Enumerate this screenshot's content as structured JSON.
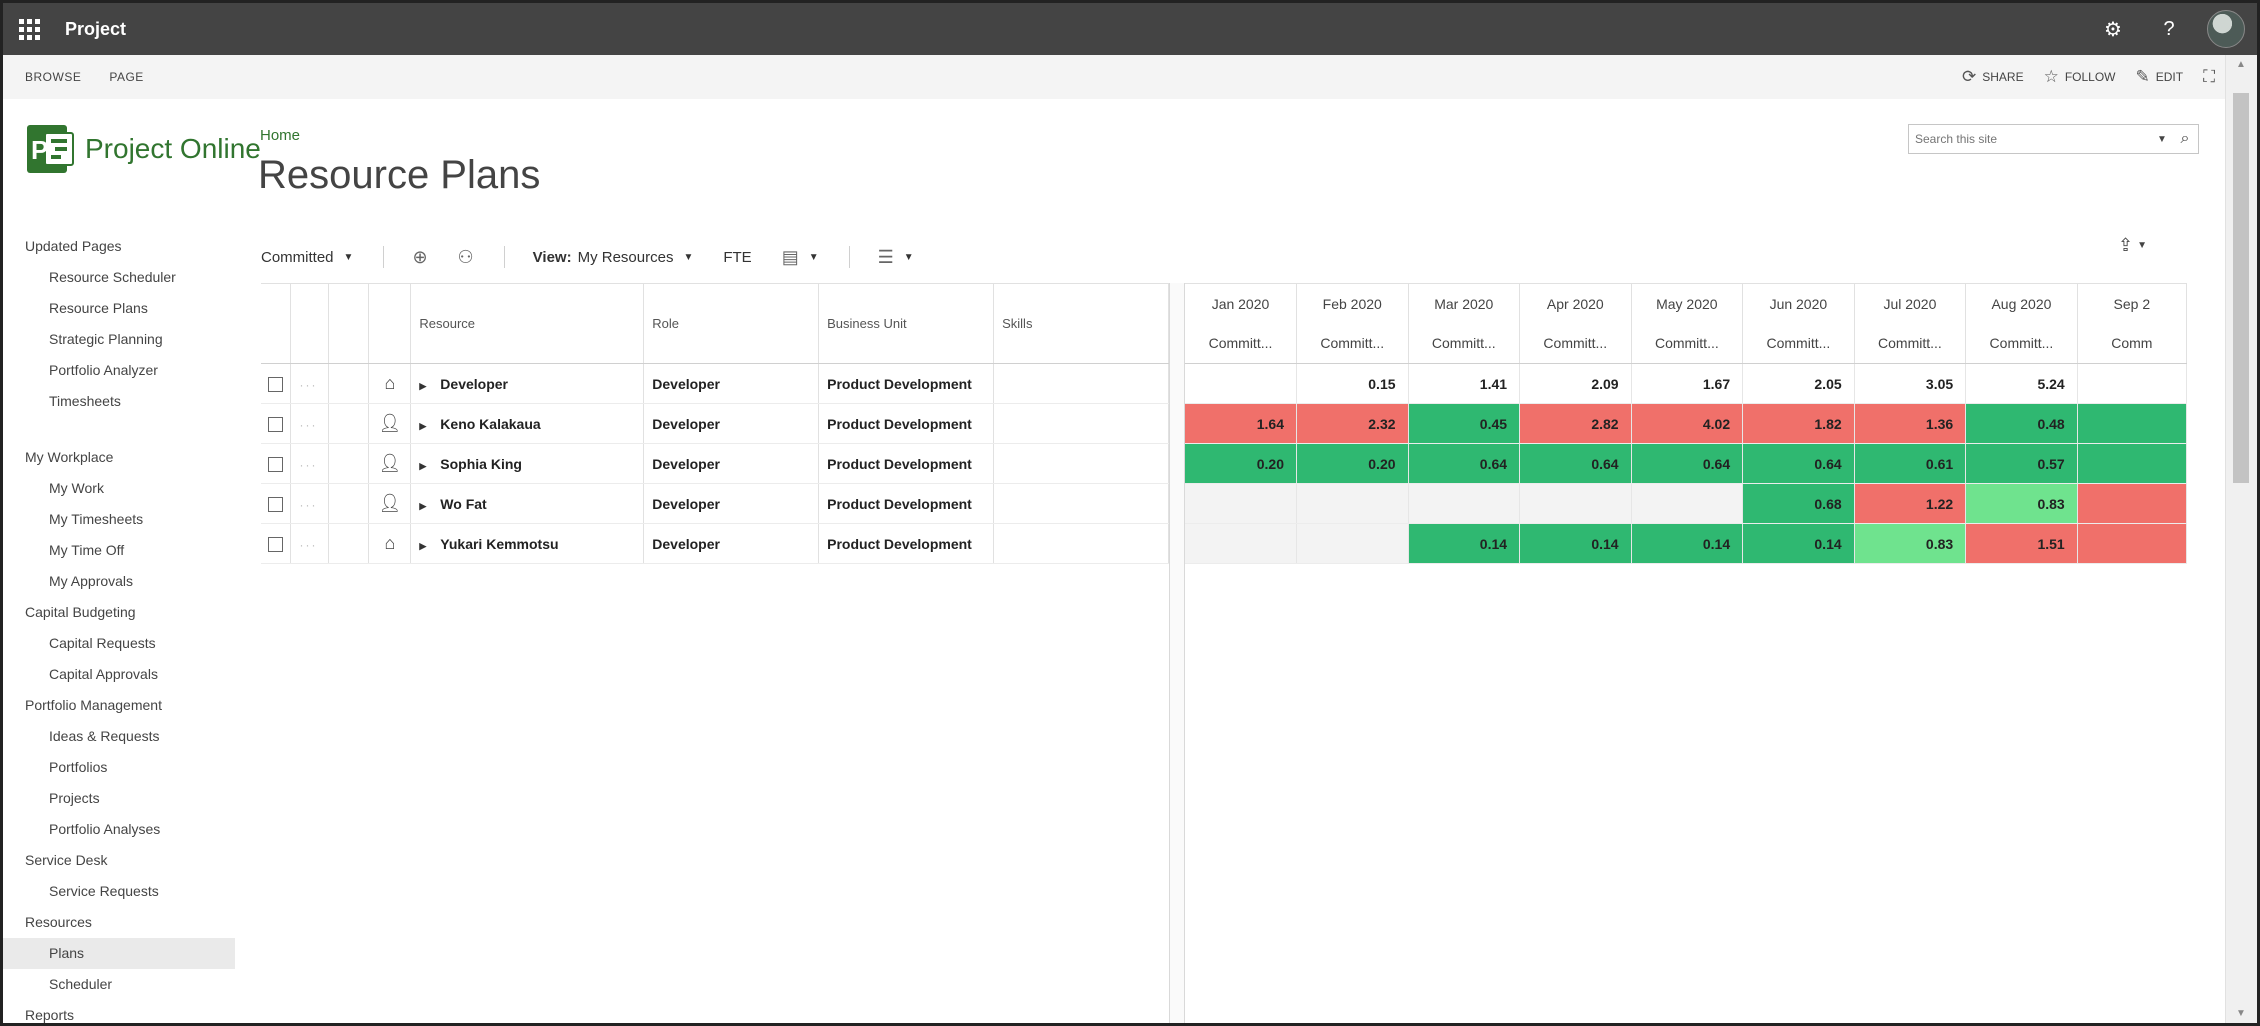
{
  "suite": {
    "title": "Project"
  },
  "ribbon": {
    "tabs": [
      "BROWSE",
      "PAGE"
    ],
    "actions": [
      "SHARE",
      "FOLLOW",
      "EDIT"
    ]
  },
  "logo": {
    "text": "Project Online",
    "brand_color": "#31752f"
  },
  "breadcrumb": "Home",
  "page_title": "Resource Plans",
  "search": {
    "placeholder": "Search this site"
  },
  "nav": [
    {
      "label": "Updated Pages",
      "level": 0
    },
    {
      "label": "Resource Scheduler",
      "level": 1
    },
    {
      "label": "Resource Plans",
      "level": 1
    },
    {
      "label": "Strategic Planning",
      "level": 1
    },
    {
      "label": "Portfolio Analyzer",
      "level": 1
    },
    {
      "label": "Timesheets",
      "level": 1
    },
    {
      "label": "",
      "level": -1
    },
    {
      "label": "My Workplace",
      "level": 0
    },
    {
      "label": "My Work",
      "level": 1
    },
    {
      "label": "My Timesheets",
      "level": 1
    },
    {
      "label": "My Time Off",
      "level": 1
    },
    {
      "label": "My Approvals",
      "level": 1
    },
    {
      "label": "Capital Budgeting",
      "level": 0
    },
    {
      "label": "Capital Requests",
      "level": 1
    },
    {
      "label": "Capital Approvals",
      "level": 1
    },
    {
      "label": "Portfolio Management",
      "level": 0
    },
    {
      "label": "Ideas & Requests",
      "level": 1
    },
    {
      "label": "Portfolios",
      "level": 1
    },
    {
      "label": "Projects",
      "level": 1
    },
    {
      "label": "Portfolio Analyses",
      "level": 1
    },
    {
      "label": "Service Desk",
      "level": 0
    },
    {
      "label": "Service Requests",
      "level": 1
    },
    {
      "label": "Resources",
      "level": 0
    },
    {
      "label": "Plans",
      "level": 1,
      "selected": true
    },
    {
      "label": "Scheduler",
      "level": 1
    },
    {
      "label": "Reports",
      "level": 0
    }
  ],
  "toolbar": {
    "committed": "Committed",
    "view_label": "View:",
    "view_value": "My Resources",
    "fte": "FTE"
  },
  "grid": {
    "columns": {
      "resource": "Resource",
      "role": "Role",
      "business_unit": "Business Unit",
      "skills": "Skills"
    },
    "months": [
      "Jan 2020",
      "Feb 2020",
      "Mar 2020",
      "Apr 2020",
      "May 2020",
      "Jun 2020",
      "Jul 2020",
      "Aug 2020",
      "Sep 2"
    ],
    "sub_header": [
      "Committ...",
      "Committ...",
      "Committ...",
      "Committ...",
      "Committ...",
      "Committ...",
      "Committ...",
      "Committ...",
      "Comm"
    ],
    "rows": [
      {
        "icon": "generic-resource-icon",
        "resource": "Developer",
        "role": "Developer",
        "business_unit": "Product Development",
        "skills": "",
        "values": [
          "",
          "0.15",
          "1.41",
          "2.09",
          "1.67",
          "2.05",
          "3.05",
          "5.24",
          ""
        ],
        "status": [
          "none",
          "none",
          "none",
          "none",
          "none",
          "none",
          "none",
          "none",
          "none"
        ]
      },
      {
        "icon": "person-icon",
        "resource": "Keno Kalakaua",
        "role": "Developer",
        "business_unit": "Product Development",
        "skills": "",
        "values": [
          "1.64",
          "2.32",
          "0.45",
          "2.82",
          "4.02",
          "1.82",
          "1.36",
          "0.48",
          ""
        ],
        "status": [
          "red",
          "red",
          "green",
          "red",
          "red",
          "red",
          "red",
          "green",
          "green"
        ]
      },
      {
        "icon": "person-icon",
        "resource": "Sophia King",
        "role": "Developer",
        "business_unit": "Product Development",
        "skills": "",
        "values": [
          "0.20",
          "0.20",
          "0.64",
          "0.64",
          "0.64",
          "0.64",
          "0.61",
          "0.57",
          ""
        ],
        "status": [
          "green",
          "green",
          "green",
          "green",
          "green",
          "green",
          "green",
          "green",
          "green"
        ]
      },
      {
        "icon": "person-icon",
        "resource": "Wo Fat",
        "role": "Developer",
        "business_unit": "Product Development",
        "skills": "",
        "values": [
          "",
          "",
          "",
          "",
          "",
          "0.68",
          "1.22",
          "0.83",
          ""
        ],
        "status": [
          "grey",
          "grey",
          "grey",
          "grey",
          "grey",
          "green",
          "red",
          "lgreen",
          "red"
        ]
      },
      {
        "icon": "generic-resource-icon",
        "resource": "Yukari Kemmotsu",
        "role": "Developer",
        "business_unit": "Product Development",
        "skills": "",
        "values": [
          "",
          "",
          "0.14",
          "0.14",
          "0.14",
          "0.14",
          "0.83",
          "1.51",
          ""
        ],
        "status": [
          "grey",
          "grey",
          "green",
          "green",
          "green",
          "green",
          "lgreen",
          "red",
          "red"
        ]
      }
    ]
  },
  "colors": {
    "over": "#f0706a",
    "under": "#2fb871",
    "near": "#6fe38e",
    "empty": "#f3f3f3"
  }
}
